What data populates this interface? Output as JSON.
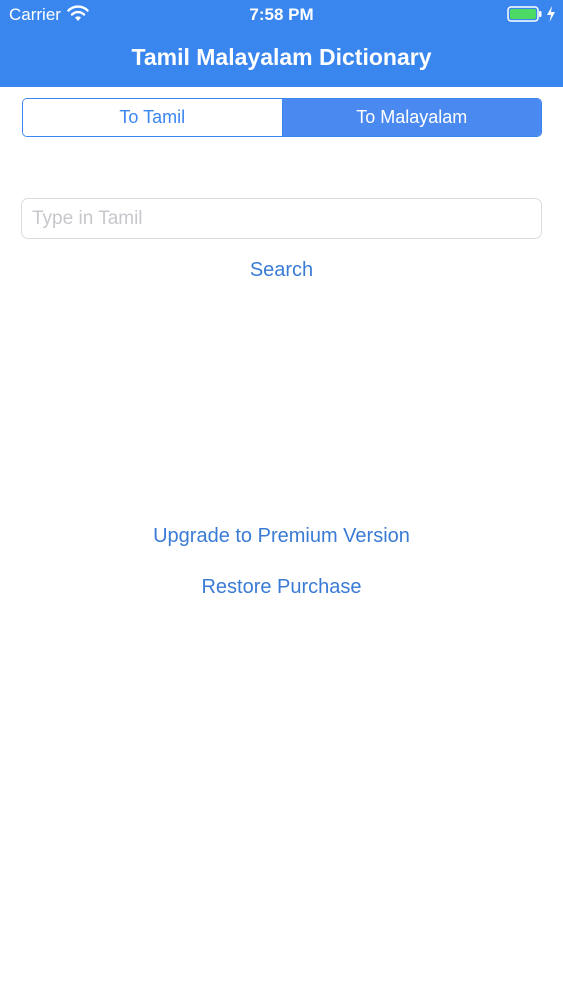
{
  "status_bar": {
    "carrier": "Carrier",
    "time": "7:58 PM",
    "battery_level": 1.0,
    "battery_color": "#4cd964"
  },
  "nav": {
    "title": "Tamil Malayalam Dictionary",
    "background": "#3a86ef"
  },
  "segments": {
    "items": [
      {
        "label": "To Tamil",
        "selected": false
      },
      {
        "label": "To Malayalam",
        "selected": true
      }
    ]
  },
  "search": {
    "value": "",
    "placeholder": "Type in Tamil",
    "button_label": "Search"
  },
  "actions": {
    "upgrade_label": "Upgrade to Premium Version",
    "restore_label": "Restore Purchase"
  },
  "colors": {
    "accent": "#3a86ef",
    "link": "#3a7bd5"
  }
}
